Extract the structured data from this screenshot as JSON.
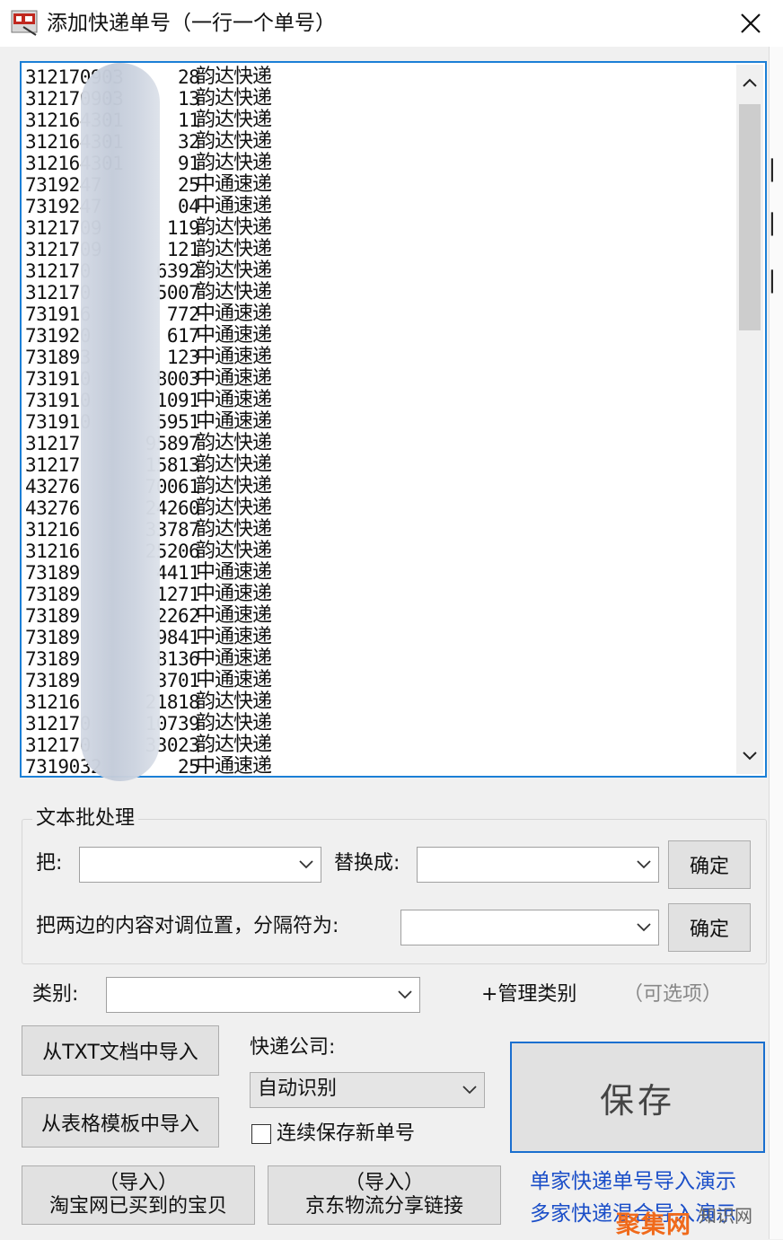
{
  "window": {
    "title": "添加快递单号（一行一个单号）",
    "close_label": "close"
  },
  "list": {
    "lines": [
      {
        "number": "312170903     28",
        "company": "韵达快递"
      },
      {
        "number": "312170903     13",
        "company": "韵达快递"
      },
      {
        "number": "312164301     11",
        "company": "韵达快递"
      },
      {
        "number": "312164301     32",
        "company": "韵达快递"
      },
      {
        "number": "312164301     91",
        "company": "韵达快递"
      },
      {
        "number": "7319247       25",
        "company": "中通速递"
      },
      {
        "number": "7319247       04",
        "company": "中通速递"
      },
      {
        "number": "3121709      119",
        "company": "韵达快递"
      },
      {
        "number": "3121709      121",
        "company": "韵达快递"
      },
      {
        "number": "312170      6392",
        "company": "韵达快递"
      },
      {
        "number": "312170      5007",
        "company": "韵达快递"
      },
      {
        "number": "731916       772",
        "company": "中通速递"
      },
      {
        "number": "731920       617",
        "company": "中通速递"
      },
      {
        "number": "731893       123",
        "company": "中通速递"
      },
      {
        "number": "731910      8003",
        "company": "中通速递"
      },
      {
        "number": "731910      1091",
        "company": "中通速递"
      },
      {
        "number": "731910      5951",
        "company": "中通速递"
      },
      {
        "number": "31217      95897",
        "company": "韵达快递"
      },
      {
        "number": "31217      15813",
        "company": "韵达快递"
      },
      {
        "number": "43276      70061",
        "company": "韵达快递"
      },
      {
        "number": "43276      24260",
        "company": "韵达快递"
      },
      {
        "number": "31216      33787",
        "company": "韵达快递"
      },
      {
        "number": "31216      25206",
        "company": "韵达快递"
      },
      {
        "number": "73189       4411",
        "company": "中通速递"
      },
      {
        "number": "73189       1271",
        "company": "中通速递"
      },
      {
        "number": "73189       2262",
        "company": "中通速递"
      },
      {
        "number": "73189       9841",
        "company": "中通速递"
      },
      {
        "number": "73189       8136",
        "company": "中通速递"
      },
      {
        "number": "73189       3701",
        "company": "中通速递"
      },
      {
        "number": "31216      21818",
        "company": "韵达快递"
      },
      {
        "number": "312170     10739",
        "company": "韵达快递"
      },
      {
        "number": "312170     33023",
        "company": "韵达快递"
      },
      {
        "number": "7319032       25",
        "company": "中通速递"
      }
    ]
  },
  "batch": {
    "title": "文本批处理",
    "replace_from_label": "把:",
    "replace_from_value": "",
    "replace_to_label": "替换成:",
    "replace_to_value": "",
    "confirm_label": "确定",
    "swap_label": "把两边的内容对调位置，分隔符为:",
    "swap_value": ""
  },
  "category": {
    "label": "类别:",
    "value": "",
    "manage_label": "+管理类别",
    "optional_hint": "（可选项）"
  },
  "import": {
    "txt_label": "从TXT文档中导入",
    "table_label": "从表格模板中导入",
    "taobao_line1": "（导入）",
    "taobao_line2": "淘宝网已买到的宝贝",
    "jd_line1": "（导入）",
    "jd_line2": "京东物流分享链接"
  },
  "courier": {
    "label": "快递公司:",
    "value": "自动识别",
    "continuous_label": "连续保存新单号",
    "continuous_checked": false
  },
  "save": {
    "label": "保存"
  },
  "demos": {
    "single": "单家快递单号导入演示",
    "multi": "多家快递混合导入演示"
  },
  "watermark": {
    "main": "聚集网",
    "sub": "知识网"
  },
  "colors": {
    "accent": "#1a6fcf",
    "link": "#1a4ec8",
    "watermark": "#f06a1b"
  }
}
